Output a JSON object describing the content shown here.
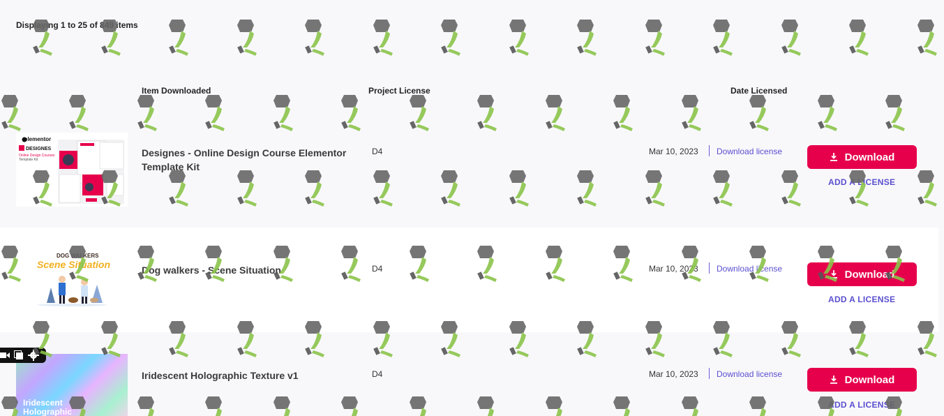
{
  "listing": {
    "count_text": "Displaying 1 to 25 of 849 items"
  },
  "columns": {
    "item": "Item Downloaded",
    "license": "Project License",
    "date": "Date Licensed"
  },
  "rows": [
    {
      "title": "Designes - Online Design Course Elementor Template Kit",
      "license": "D4",
      "date": "Mar 10, 2023",
      "download_link": "Download license",
      "download_button": "Download",
      "add_license": "ADD A LICENSE",
      "thumb": {
        "brand": "elementor",
        "name": "DESIGNES",
        "subtitle": "Online Design Courses",
        "subtitle2": "Template Kit"
      }
    },
    {
      "title": "Dog walkers - Scene Situation",
      "license": "D4",
      "date": "Mar 10, 2023",
      "download_link": "Download license",
      "download_button": "Download",
      "add_license": "ADD A LICENSE",
      "thumb": {
        "top_text": "DOG WALKERS",
        "script_text": "Scene Situation"
      }
    },
    {
      "title": "Iridescent Holographic Texture v1",
      "license": "D4",
      "date": "Mar 10, 2023",
      "download_link": "Download license",
      "download_button": "Download",
      "add_license": "ADD A LICENSE",
      "thumb": {
        "line1": "Iridescent",
        "line2": "Holographic"
      }
    }
  ],
  "colors": {
    "accent": "#e6004c",
    "link": "#5a4fcf"
  },
  "icons": {
    "download": "download-icon",
    "video": "video-icon",
    "layers": "copy-icon",
    "settings": "gear-icon"
  }
}
